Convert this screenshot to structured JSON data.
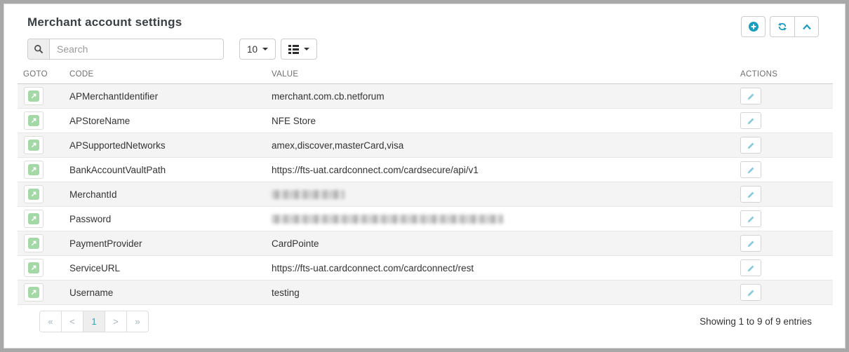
{
  "panel": {
    "title": "Merchant account settings"
  },
  "toolbar": {
    "search": {
      "placeholder": "Search",
      "value": "",
      "icon": "magnifier-icon"
    },
    "page_size": {
      "value": "10",
      "icon": "caret-down-icon"
    },
    "columns": {
      "icon": "list-icon",
      "caret": "caret-down-icon"
    },
    "buttons": [
      {
        "name": "add",
        "icon": "plus-circle-icon"
      },
      {
        "name": "refresh",
        "icon": "refresh-icon"
      },
      {
        "name": "collapse",
        "icon": "chevron-up-icon"
      }
    ]
  },
  "table": {
    "headers": {
      "goto": "GOTO",
      "code": "CODE",
      "value": "VALUE",
      "actions": "ACTIONS"
    },
    "row_icon": "goto-arrow-icon",
    "action_icon": "edit-pencil-icon",
    "rows": [
      {
        "code": "APMerchantIdentifier",
        "value": "merchant.com.cb.netforum",
        "redacted": false
      },
      {
        "code": "APStoreName",
        "value": "NFE Store",
        "redacted": false
      },
      {
        "code": "APSupportedNetworks",
        "value": "amex,discover,masterCard,visa",
        "redacted": false
      },
      {
        "code": "BankAccountVaultPath",
        "value": "https://fts-uat.cardconnect.com/cardsecure/api/v1",
        "redacted": false
      },
      {
        "code": "MerchantId",
        "value": "",
        "redacted": true
      },
      {
        "code": "Password",
        "value": "",
        "redacted": true
      },
      {
        "code": "PaymentProvider",
        "value": "CardPointe",
        "redacted": false
      },
      {
        "code": "ServiceURL",
        "value": "https://fts-uat.cardconnect.com/cardconnect/rest",
        "redacted": false
      },
      {
        "code": "Username",
        "value": "testing",
        "redacted": false
      }
    ]
  },
  "pagination": {
    "first": "«",
    "prev": "<",
    "page": "1",
    "next": ">",
    "last": "»",
    "active": "1"
  },
  "footer": {
    "summary": "Showing 1 to 9 of 9 entries"
  },
  "colors": {
    "accent_teal": "#1b9dbb",
    "goto_green": "#a5d8a7",
    "edit_blue": "#8ccadd",
    "stripe": "#f4f4f4",
    "frame_gray": "#a8a8a8"
  }
}
